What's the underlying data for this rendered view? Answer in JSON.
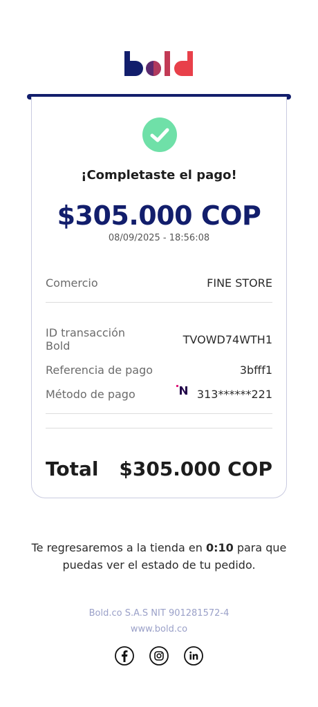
{
  "logo": {
    "text": "bold"
  },
  "receipt": {
    "title": "¡Completaste el pago!",
    "amount": "$305.000 COP",
    "datetime": "08/09/2025 - 18:56:08",
    "merchant_label": "Comercio",
    "merchant_value": "FINE STORE",
    "txn_label_line1": "ID transacción",
    "txn_label_line2": "Bold",
    "txn_value": "TVOWD74WTH1",
    "ref_label": "Referencia de pago",
    "ref_value": "3bfff1",
    "method_label": "Método de pago",
    "method_value": "313******221",
    "method_icon": "nequi-icon",
    "total_label": "Total",
    "total_value": "$305.000 COP"
  },
  "redirect": {
    "prefix": "Te regresaremos a la tienda en ",
    "countdown": "0:10",
    "suffix": " para que puedas ver el estado de tu pedido."
  },
  "footer": {
    "company": "Bold.co S.A.S NIT 901281572-4",
    "website": "www.bold.co",
    "social": [
      "facebook-icon",
      "instagram-icon",
      "linkedin-icon"
    ]
  },
  "colors": {
    "brand_navy": "#121e6c",
    "success_green": "#6fe0a8",
    "logo_red": "#e8404a",
    "muted": "#9aa0c8"
  }
}
